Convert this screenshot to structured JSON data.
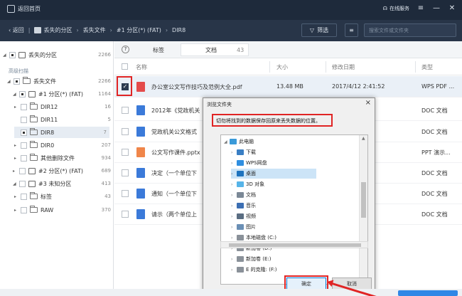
{
  "topbar": {
    "back_home": "返回首页",
    "service": "在线服务"
  },
  "navbar": {
    "back": "返回",
    "breadcrumb": [
      "丢失的分区",
      "丢失文件",
      "#1 分区(*) (FAT)",
      "DIR8"
    ],
    "filter": "筛选",
    "search_placeholder": "搜索文件或文件夹"
  },
  "tree": {
    "root": {
      "label": "丢失的分区",
      "count": "2266"
    },
    "section": "高级扫描",
    "lost_files": {
      "label": "丢失文件",
      "count": "2266"
    },
    "part1": {
      "label": "#1 分区(*) (FAT)",
      "count": "1164"
    },
    "dirs": [
      {
        "label": "DIR12",
        "count": "16"
      },
      {
        "label": "DIR11",
        "count": "5"
      },
      {
        "label": "DIR8",
        "count": "7"
      },
      {
        "label": "DIR0",
        "count": "207"
      },
      {
        "label": "其他删除文件",
        "count": "934"
      }
    ],
    "part2": {
      "label": "#2 分区(*) (FAT)",
      "count": "689"
    },
    "part3": {
      "label": "#3 未知分区",
      "count": "413"
    },
    "tags": {
      "label": "标签",
      "count": "43"
    },
    "raw": {
      "label": "RAW",
      "count": "370"
    }
  },
  "tabs": {
    "tag": "标签",
    "doc": "文档",
    "doc_count": "43"
  },
  "table": {
    "headers": [
      "名称",
      "大小",
      "修改日期",
      "类型"
    ],
    "rows": [
      {
        "name": "办公室公文写作技巧及范例大全.pdf",
        "size": "13.48 MB",
        "time": "2017/4/12 2:41:52",
        "type": "WPS PDF ..."
      },
      {
        "name": "2012年《党政机关",
        "size": "",
        "time": "10",
        "type": "DOC 文档"
      },
      {
        "name": "党政机关公文格式",
        "size": "",
        "time": "10",
        "type": "DOC 文档"
      },
      {
        "name": "公文写作课件.pptx",
        "size": "",
        "time": "6",
        "type": "PPT 演示..."
      },
      {
        "name": "决定（一个单位下",
        "size": "",
        "time": "10",
        "type": "DOC 文档"
      },
      {
        "name": "通知（一个单位下",
        "size": "",
        "time": "10",
        "type": "DOC 文档"
      },
      {
        "name": "请示（两个单位上",
        "size": "",
        "time": "10",
        "type": "DOC 文档"
      }
    ]
  },
  "dialog": {
    "title": "浏览文件夹",
    "close": "×",
    "message": "切勿将找到的数据保存回原来丢失数据的位置。",
    "items": [
      {
        "label": "此电脑",
        "icon": "computer-icon"
      },
      {
        "label": "下载",
        "icon": "download-icon"
      },
      {
        "label": "WPS网盘",
        "icon": "cloud-icon"
      },
      {
        "label": "桌面",
        "icon": "desktop-icon"
      },
      {
        "label": "3D 对象",
        "icon": "cube-icon"
      },
      {
        "label": "文档",
        "icon": "document-icon"
      },
      {
        "label": "音乐",
        "icon": "music-icon"
      },
      {
        "label": "视频",
        "icon": "video-icon"
      },
      {
        "label": "图片",
        "icon": "picture-icon"
      },
      {
        "label": "本地磁盘 (C:)",
        "icon": "drive-icon"
      },
      {
        "label": "新加卷 (D:)",
        "icon": "drive-icon"
      },
      {
        "label": "新加卷 (E:)",
        "icon": "drive-icon"
      },
      {
        "label": "E 的克隆: (F:)",
        "icon": "drive-icon"
      }
    ],
    "ok": "确定",
    "cancel": "取消"
  },
  "colors": {
    "accent": "#2f87e6",
    "highlight": "#e02424",
    "topbar": "#1e2a3b"
  }
}
